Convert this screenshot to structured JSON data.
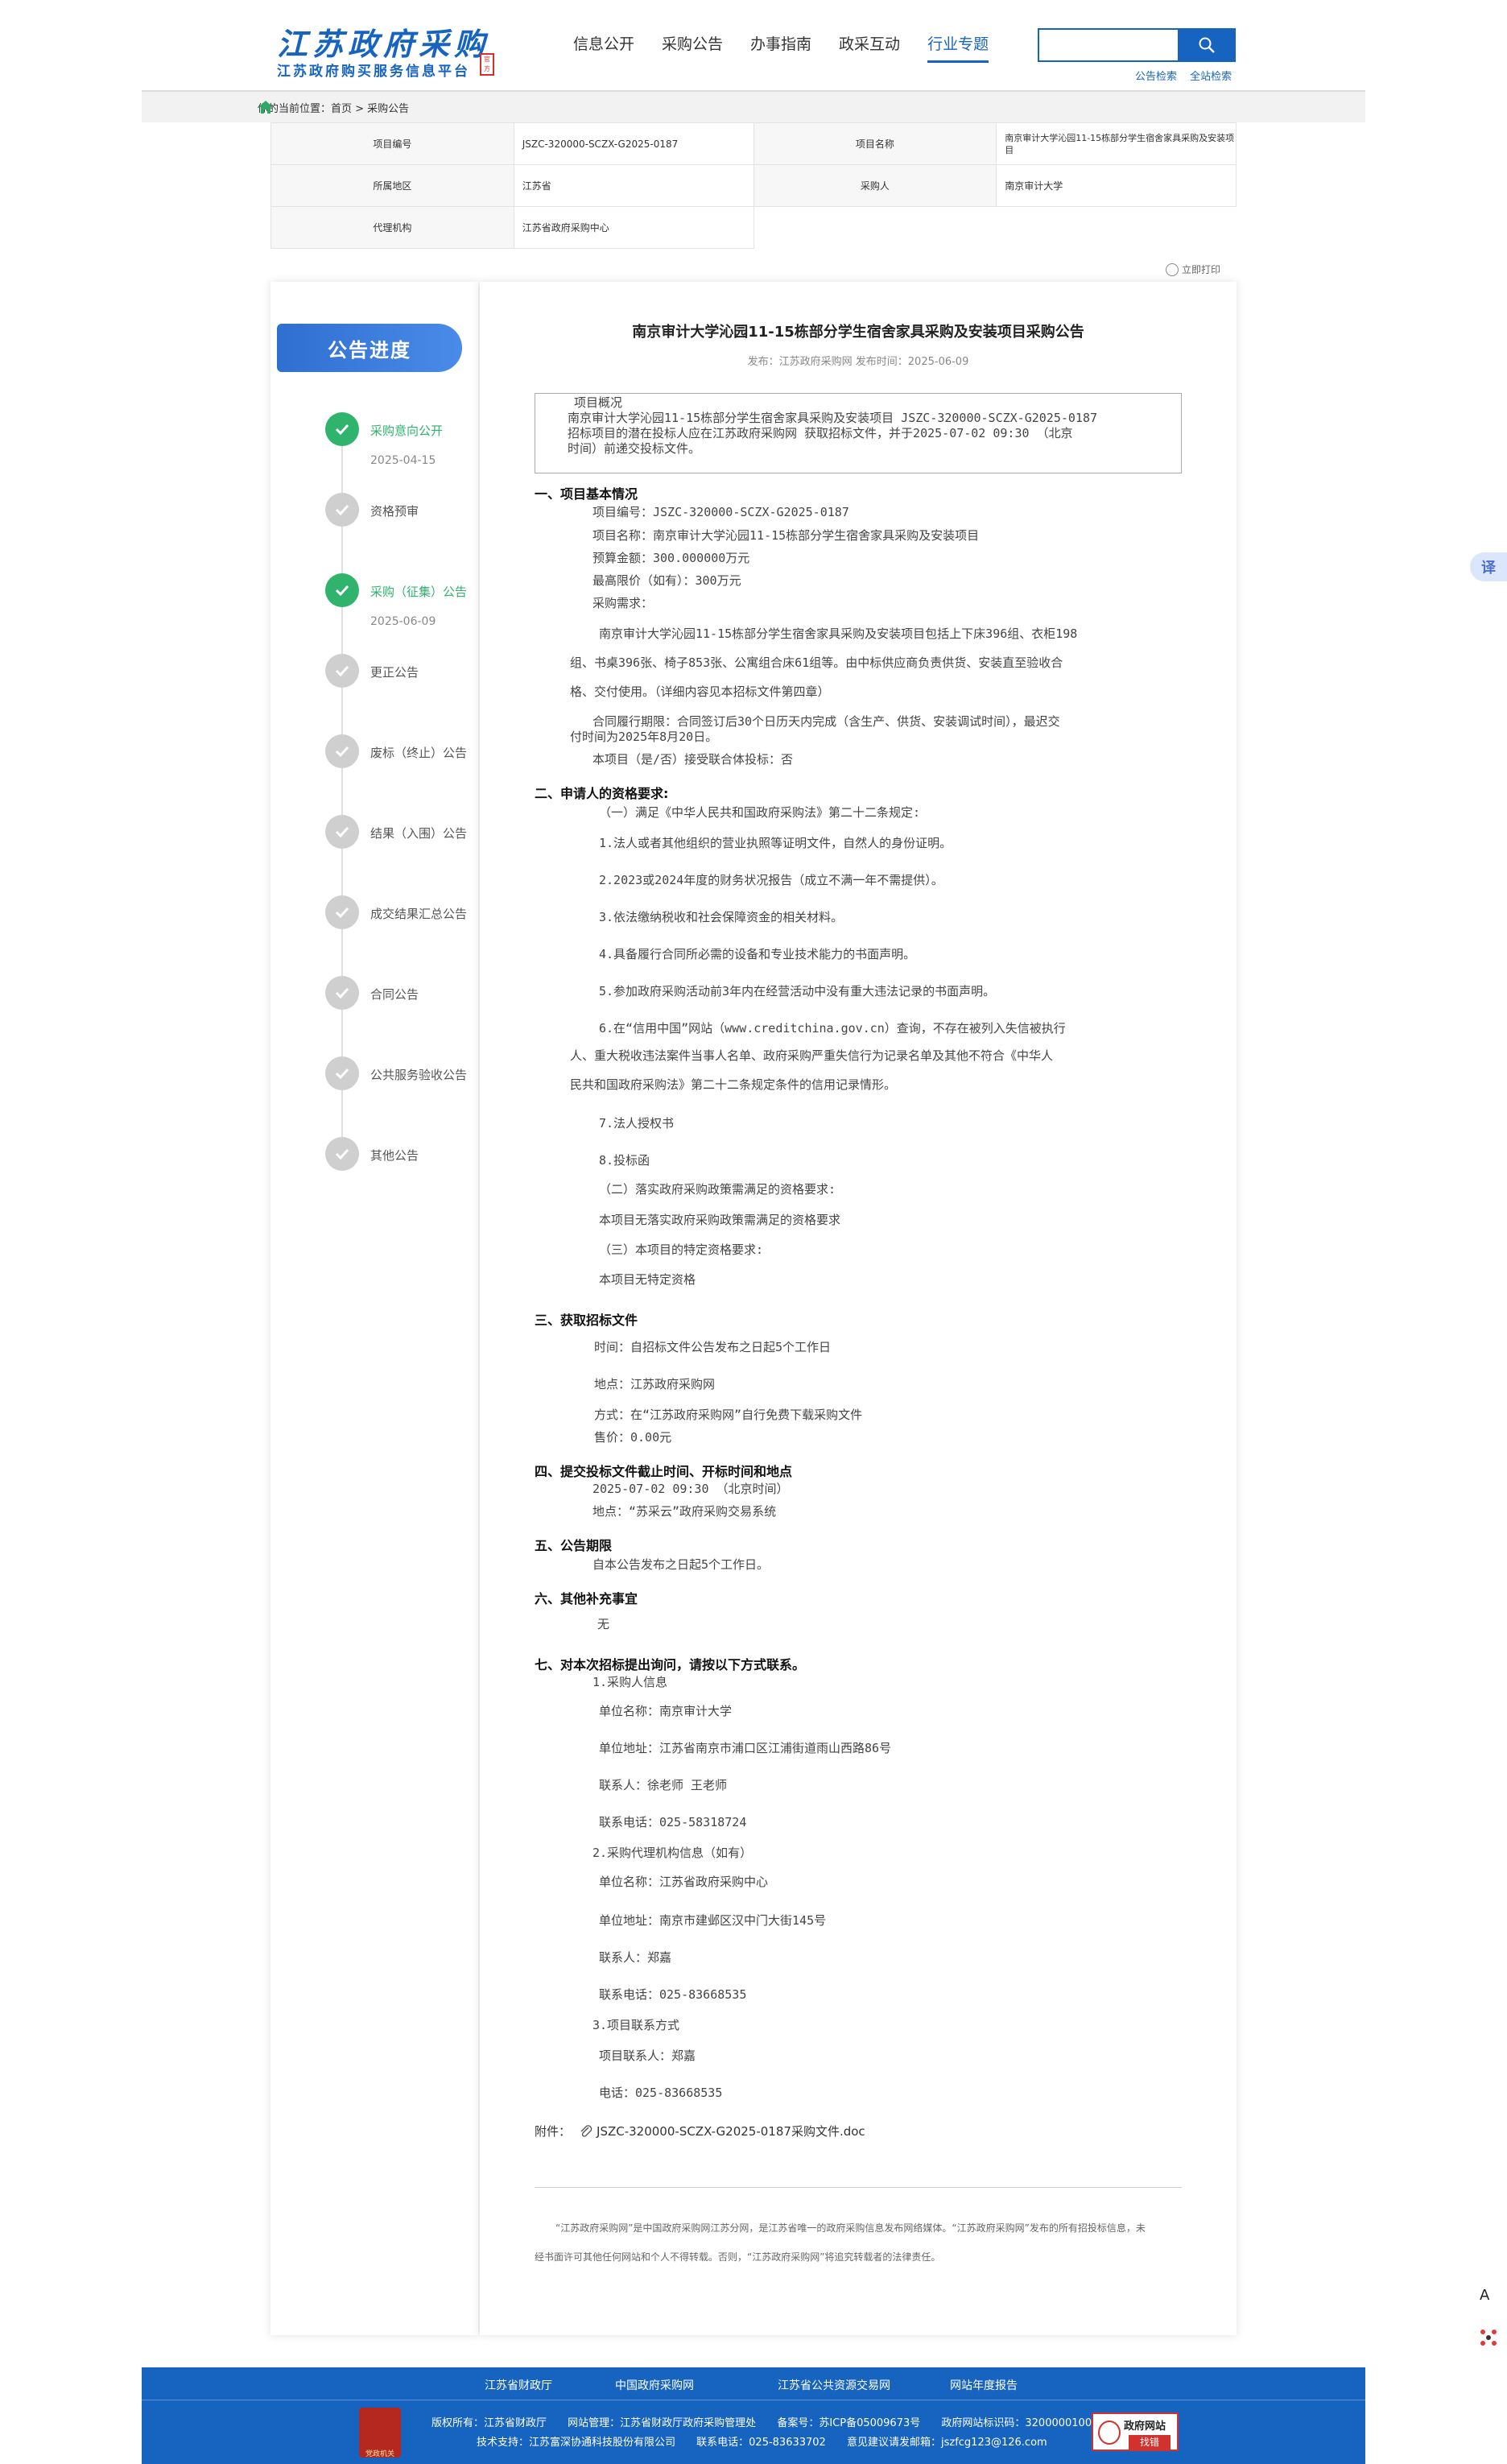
{
  "header": {
    "logo_script": "江苏政府采购",
    "logo_sub": "江苏政府购买服务信息平台",
    "logo_seal": "官方",
    "nav": [
      "信息公开",
      "采购公告",
      "办事指南",
      "政采互动",
      "行业专题"
    ],
    "search_links": [
      "公告检索",
      "全站检索"
    ]
  },
  "breadcrumb": "你的当前位置：首页 > 采购公告",
  "info": {
    "l_code": "项目编号",
    "v_code": "JSZC-320000-SCZX-G2025-0187",
    "l_name": "项目名称",
    "v_name": "南京审计大学沁园11-15栋部分学生宿舍家具采购及安装项目",
    "l_region": "所属地区",
    "v_region": "江苏省",
    "l_buyer": "采购人",
    "v_buyer": "南京审计大学",
    "l_agent": "代理机构",
    "v_agent": "江苏省政府采购中心"
  },
  "print_label": "立即打印",
  "progress": {
    "title": "公告进度",
    "steps": [
      {
        "label": "采购意向公开",
        "date": "2025-04-15"
      },
      {
        "label": "资格预审"
      },
      {
        "label": "采购（征集）公告",
        "date": "2025-06-09"
      },
      {
        "label": "更正公告"
      },
      {
        "label": "废标（终止）公告"
      },
      {
        "label": "结果（入围）公告"
      },
      {
        "label": "成交结果汇总公告"
      },
      {
        "label": "合同公告"
      },
      {
        "label": "公共服务验收公告"
      },
      {
        "label": "其他公告"
      }
    ]
  },
  "article": {
    "title": "南京审计大学沁园11-15栋部分学生宿舍家具采购及安装项目采购公告",
    "meta": "发布：江苏政府采购网   发布时间：2025-06-09",
    "summary": [
      "项目概况",
      "南京审计大学沁园11-15栋部分学生宿舍家具采购及安装项目 JSZC-320000-SCZX-G2025-0187",
      "招标项目的潜在投标人应在江苏政府采购网 获取招标文件，并于2025-07-02 09:30 （北京",
      "时间）前递交投标文件。"
    ],
    "s1": {
      "h": "一、项目基本情况",
      "lines": [
        "项目编号：JSZC-320000-SCZX-G2025-0187",
        "项目名称：南京审计大学沁园11-15栋部分学生宿舍家具采购及安装项目",
        "预算金额：300.000000万元",
        "最高限价（如有）：300万元",
        "采购需求："
      ],
      "req": [
        "南京审计大学沁园11-15栋部分学生宿舍家具采购及安装项目包括上下床396组、衣柜198",
        "组、书桌396张、椅子853张、公寓组合床61组等。由中标供应商负责供货、安装直至验收合",
        "格、交付使用。（详细内容见本招标文件第四章）"
      ],
      "contract": [
        "合同履行期限：合同签订后30个日历天内完成（含生产、供货、安装调试时间），最迟交",
        "付时间为2025年8月20日。"
      ],
      "joint": "本项目（是/否）接受联合体投标：否"
    },
    "s2": {
      "h": "二、申请人的资格要求:",
      "lines": [
        "（一）满足《中华人民共和国政府采购法》第二十二条规定:",
        "1.法人或者其他组织的营业执照等证明文件，自然人的身份证明。",
        "2.2023或2024年度的财务状况报告（成立不满一年不需提供）。",
        "3.依法缴纳税收和社会保障资金的相关材料。",
        "4.具备履行合同所必需的设备和专业技术能力的书面声明。",
        "5.参加政府采购活动前3年内在经营活动中没有重大违法记录的书面声明。",
        "6.在“信用中国”网站（www.creditchina.gov.cn）查询，不存在被列入失信被执行",
        "人、重大税收违法案件当事人名单、政府采购严重失信行为记录名单及其他不符合《中华人",
        "民共和国政府采购法》第二十二条规定条件的信用记录情形。",
        "7.法人授权书",
        "8.投标函",
        "（二）落实政府采购政策需满足的资格要求:",
        "本项目无落实政府采购政策需满足的资格要求",
        "（三）本项目的特定资格要求:",
        "本项目无特定资格"
      ]
    },
    "s3": {
      "h": "三、获取招标文件",
      "lines": [
        "时间：自招标文件公告发布之日起5个工作日",
        "地点：江苏政府采购网",
        "方式：在“江苏政府采购网”自行免费下载采购文件",
        "售价：0.00元"
      ]
    },
    "s4": {
      "h": "四、提交投标文件截止时间、开标时间和地点",
      "lines": [
        "2025-07-02 09:30 （北京时间）",
        "地点：“苏采云”政府采购交易系统"
      ]
    },
    "s5": {
      "h": "五、公告期限",
      "lines": [
        "自本公告发布之日起5个工作日。"
      ]
    },
    "s6": {
      "h": "六、其他补充事宜",
      "lines": [
        "无"
      ]
    },
    "s7": {
      "h": "七、对本次招标提出询问，请按以下方式联系。",
      "lines": [
        "1.采购人信息",
        "单位名称：南京审计大学",
        "单位地址：江苏省南京市浦口区江浦街道雨山西路86号",
        "联系人：徐老师 王老师",
        "联系电话：025-58318724",
        "2.采购代理机构信息（如有）",
        "单位名称：江苏省政府采购中心",
        "单位地址：南京市建邺区汉中门大街145号",
        "联系人：郑嘉",
        "联系电话：025-83668535",
        "3.项目联系方式",
        "项目联系人：郑嘉",
        "电话：025-83668535"
      ]
    },
    "attachment_label": "附件：",
    "attachment_file": "JSZC-320000-SCZX-G2025-0187采购文件.doc",
    "disclaimer": [
      "“江苏政府采购网”是中国政府采购网江苏分网，是江苏省唯一的政府采购信息发布网络媒体。“江苏政府采购网”发布的所有招投标信息，未",
      "经书面许可其他任何网站和个人不得转载。否则，“江苏政府采购网”将追究转载者的法律责任。"
    ]
  },
  "floats": {
    "translate": "译",
    "a11y": "A"
  },
  "footer": {
    "links": [
      "江苏省财政厅",
      "中国政府采购网",
      "江苏省公共资源交易网",
      "网站年度报告"
    ],
    "emblem": "党政机关",
    "line1": [
      "版权所有：江苏省财政厅",
      "网站管理：江苏省财政厅政府采购管理处",
      "备案号：苏ICP备05009673号",
      "政府网站标识码：3200000100"
    ],
    "line2": [
      "技术支持：江苏富深协通科技股份有限公司",
      "联系电话：025-83633702",
      "意见建议请发邮箱：jszfcg123@126.com"
    ],
    "badge_top": "政府网站",
    "badge_bottom": "找错"
  }
}
